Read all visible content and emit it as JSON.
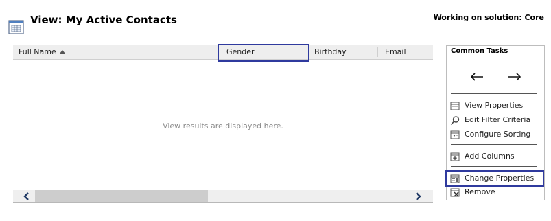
{
  "header": {
    "title": "View: My Active Contacts",
    "solution_label": "Working on solution: Core"
  },
  "grid": {
    "columns": [
      {
        "label": "Full Name",
        "sorted": "ascending"
      },
      {
        "label": "Gender",
        "highlighted": true
      },
      {
        "label": "Birthday"
      },
      {
        "label": "Email"
      }
    ],
    "empty_message": "View results are displayed here."
  },
  "common_tasks": {
    "title": "Common Tasks",
    "move_left_icon": "arrow-left-icon",
    "move_right_icon": "arrow-right-icon",
    "items": [
      {
        "label": "View Properties",
        "icon": "view-properties-icon"
      },
      {
        "label": "Edit Filter Criteria",
        "icon": "magnifier-icon"
      },
      {
        "label": "Configure Sorting",
        "icon": "sort-icon"
      },
      {
        "label": "Add Columns",
        "icon": "add-columns-icon"
      },
      {
        "label": "Change Properties",
        "icon": "change-properties-icon",
        "highlighted": true
      },
      {
        "label": "Remove",
        "icon": "remove-icon"
      }
    ]
  },
  "colors": {
    "highlight": "#2f3a9e",
    "header_bg": "#eeeeee"
  }
}
